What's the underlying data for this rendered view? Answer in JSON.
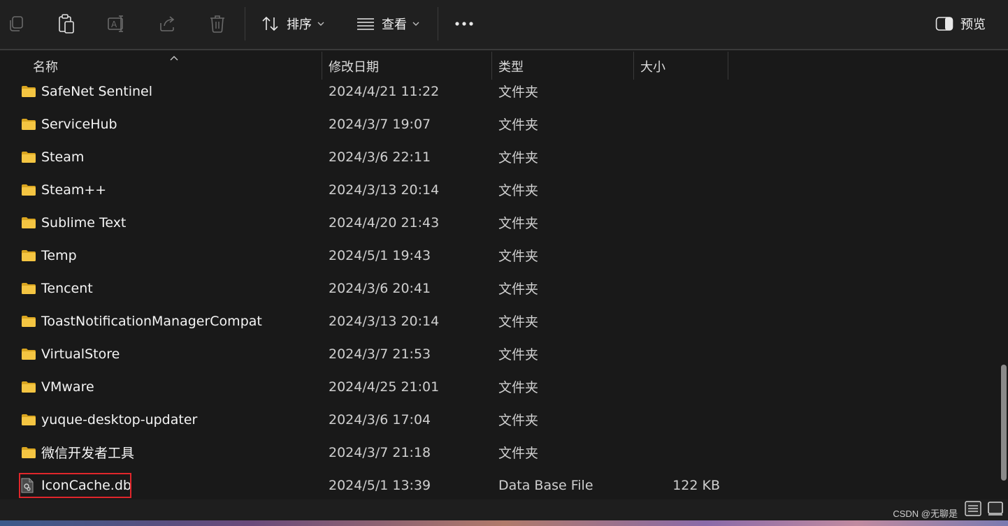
{
  "toolbar": {
    "copy_icon": "copy-icon",
    "paste_icon": "paste-icon",
    "rename_icon": "rename-icon",
    "share_icon": "share-icon",
    "delete_icon": "trash-icon",
    "sort_label": "排序",
    "view_label": "查看",
    "more_icon": "more-icon",
    "preview_label": "预览"
  },
  "columns": {
    "name": "名称",
    "date": "修改日期",
    "type": "类型",
    "size": "大小"
  },
  "files": [
    {
      "name": "SafeNet Sentinel",
      "date": "2024/4/21 11:22",
      "type": "文件夹",
      "size": "",
      "icon": "folder-icon"
    },
    {
      "name": "ServiceHub",
      "date": "2024/3/7 19:07",
      "type": "文件夹",
      "size": "",
      "icon": "folder-icon"
    },
    {
      "name": "Steam",
      "date": "2024/3/6 22:11",
      "type": "文件夹",
      "size": "",
      "icon": "folder-icon"
    },
    {
      "name": "Steam++",
      "date": "2024/3/13 20:14",
      "type": "文件夹",
      "size": "",
      "icon": "folder-icon"
    },
    {
      "name": "Sublime Text",
      "date": "2024/4/20 21:43",
      "type": "文件夹",
      "size": "",
      "icon": "folder-icon"
    },
    {
      "name": "Temp",
      "date": "2024/5/1 19:43",
      "type": "文件夹",
      "size": "",
      "icon": "folder-icon"
    },
    {
      "name": "Tencent",
      "date": "2024/3/6 20:41",
      "type": "文件夹",
      "size": "",
      "icon": "folder-icon"
    },
    {
      "name": "ToastNotificationManagerCompat",
      "date": "2024/3/13 20:14",
      "type": "文件夹",
      "size": "",
      "icon": "folder-icon"
    },
    {
      "name": "VirtualStore",
      "date": "2024/3/7 21:53",
      "type": "文件夹",
      "size": "",
      "icon": "folder-icon"
    },
    {
      "name": "VMware",
      "date": "2024/4/25 21:01",
      "type": "文件夹",
      "size": "",
      "icon": "folder-icon"
    },
    {
      "name": "yuque-desktop-updater",
      "date": "2024/3/6 17:04",
      "type": "文件夹",
      "size": "",
      "icon": "folder-icon"
    },
    {
      "name": "微信开发者工具",
      "date": "2024/3/7 21:18",
      "type": "文件夹",
      "size": "",
      "icon": "folder-icon"
    },
    {
      "name": "IconCache.db",
      "date": "2024/5/1 13:39",
      "type": "Data Base File",
      "size": "122 KB",
      "icon": "db-file-icon"
    }
  ],
  "watermark": "CSDN @无聊是",
  "colors": {
    "background": "#191919",
    "toolbar": "#202020",
    "folder": "#f4c542",
    "highlight": "#e0262b"
  }
}
